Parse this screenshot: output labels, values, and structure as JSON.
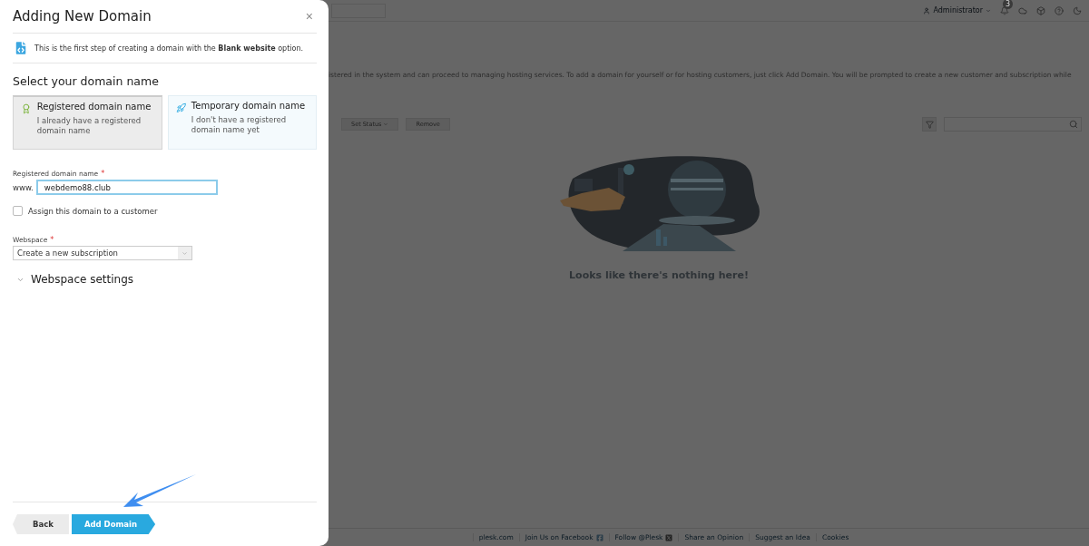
{
  "dialog": {
    "title": "Adding New Domain",
    "close": "×",
    "info": "This is the first step of creating a domain with the **Blank website** option.",
    "section_title": "Select your domain name",
    "options": [
      {
        "kind": "registered",
        "title": "Registered domain name",
        "description": "I already have a registered domain name",
        "selected": true
      },
      {
        "kind": "temporary",
        "title": "Temporary domain name",
        "description": "I don't have a registered domain name yet",
        "selected": false
      }
    ],
    "domain_field": {
      "label": "Registered domain name",
      "required_mark": "*",
      "prefix": "www.",
      "value": "webdemo88.club"
    },
    "assign_checkbox": {
      "label": "Assign this domain to a customer",
      "checked": false
    },
    "webspace": {
      "label": "Webspace",
      "required_mark": "*",
      "value": "Create a new subscription"
    },
    "webspace_settings": {
      "label": "Webspace settings",
      "expanded": false
    },
    "buttons": [
      {
        "kind": "secondary",
        "label": "Back"
      },
      {
        "kind": "primary",
        "label": "Add Domain"
      }
    ]
  },
  "background": {
    "user": "Administrator",
    "notification_count": "3",
    "description": "istered in the system and can proceed to managing hosting services. To add a domain for yourself or for hosting customers, just click Add Domain. You will be prompted to create a new customer and subscription while",
    "toolbar": [
      {
        "kind": "menu",
        "label": "Set Status"
      },
      {
        "kind": "plain",
        "label": "Remove"
      }
    ],
    "empty_message": "Looks like there's nothing here!",
    "footer": [
      {
        "kind": "text",
        "label": "plesk.com"
      },
      {
        "kind": "facebook",
        "label": "Join Us on Facebook"
      },
      {
        "kind": "x",
        "label": "Follow @Plesk"
      },
      {
        "kind": "text",
        "label": "Share an Opinion"
      },
      {
        "kind": "text",
        "label": "Suggest an Idea"
      },
      {
        "kind": "text",
        "label": "Cookies"
      }
    ]
  }
}
